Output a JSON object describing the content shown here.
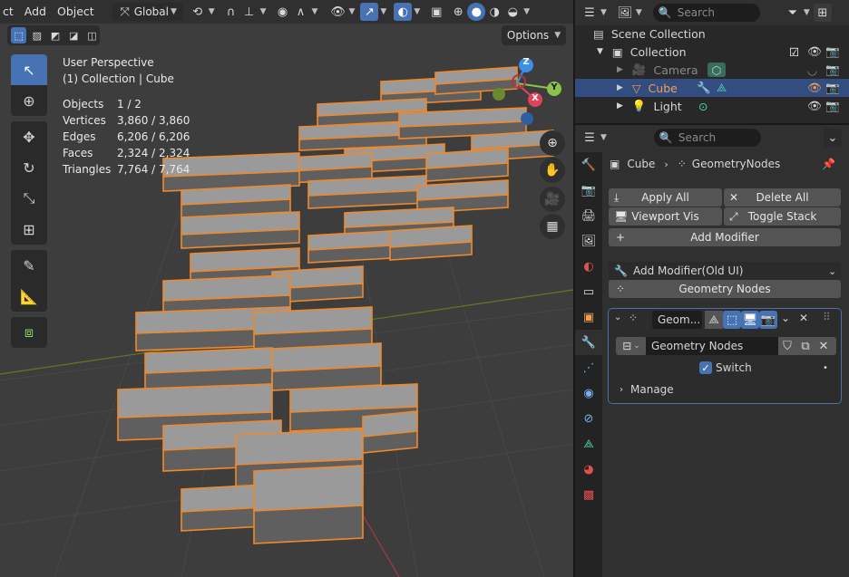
{
  "header": {
    "menus": [
      "ct",
      "Add",
      "Object"
    ],
    "orientation": "Global",
    "options_label": "Options"
  },
  "overlay": {
    "view_name": "User Perspective",
    "collection_line": "(1) Collection | Cube",
    "stats": [
      {
        "label": "Objects",
        "value": "1 / 2"
      },
      {
        "label": "Vertices",
        "value": "3,860 / 3,860"
      },
      {
        "label": "Edges",
        "value": "6,206 / 6,206"
      },
      {
        "label": "Faces",
        "value": "2,324 / 2,324"
      },
      {
        "label": "Triangles",
        "value": "7,764 / 7,764"
      }
    ]
  },
  "gizmo": {
    "x": "X",
    "y": "Y",
    "z": "Z"
  },
  "outliner": {
    "search_placeholder": "Search",
    "scene_collection": "Scene Collection",
    "items": [
      {
        "label": "Collection"
      },
      {
        "label": "Camera"
      },
      {
        "label": "Cube"
      },
      {
        "label": "Light"
      }
    ]
  },
  "properties": {
    "search_placeholder": "Search",
    "breadcrumb_object": "Cube",
    "breadcrumb_modifier": "GeometryNodes",
    "apply_all": "Apply All",
    "delete_all": "Delete All",
    "viewport_vis": "Viewport Vis",
    "toggle_stack": "Toggle Stack",
    "add_modifier": "Add Modifier",
    "add_modifier_old": "Add Modifier(Old UI)",
    "geometry_nodes_btn": "Geometry Nodes",
    "modifier": {
      "name": "Geom...",
      "node_group": "Geometry Nodes",
      "switch_label": "Switch",
      "switch_checked": true,
      "manage_label": "Manage"
    }
  },
  "colors": {
    "accent": "#4772b3",
    "selection_outline": "#f0892b",
    "x_axis": "#e0445a",
    "y_axis": "#8bc34a",
    "z_axis": "#3d8ee6"
  }
}
